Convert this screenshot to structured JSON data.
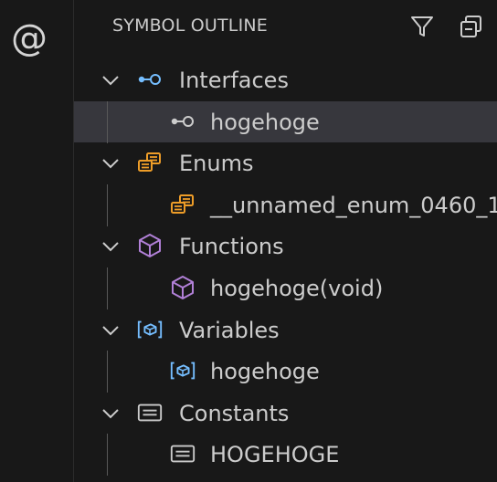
{
  "activity_bar": {
    "icon": "at-sign-icon",
    "glyph": "@"
  },
  "panel": {
    "title": "SYMBOL OUTLINE",
    "actions": [
      {
        "name": "filter-icon"
      },
      {
        "name": "collapse-all-icon"
      }
    ]
  },
  "tree": [
    {
      "label": "Interfaces",
      "icon": "interface-icon",
      "color": "#75beff",
      "expanded": true,
      "children": [
        {
          "label": "hogehoge",
          "icon": "interface-icon",
          "color": "#cccccc",
          "selected": true
        }
      ]
    },
    {
      "label": "Enums",
      "icon": "enum-icon",
      "color": "#ee9d28",
      "expanded": true,
      "children": [
        {
          "label": "__unnamed_enum_0460_1",
          "icon": "enum-icon",
          "color": "#ee9d28"
        }
      ]
    },
    {
      "label": "Functions",
      "icon": "function-cube-icon",
      "color": "#b180d7",
      "expanded": true,
      "children": [
        {
          "label": "hogehoge(void)",
          "icon": "function-cube-icon",
          "color": "#b180d7"
        }
      ]
    },
    {
      "label": "Variables",
      "icon": "variable-icon",
      "color": "#75beff",
      "expanded": true,
      "children": [
        {
          "label": "hogehoge",
          "icon": "variable-icon",
          "color": "#75beff"
        }
      ]
    },
    {
      "label": "Constants",
      "icon": "constant-icon",
      "color": "#cccccc",
      "expanded": true,
      "children": [
        {
          "label": "HOGEHOGE",
          "icon": "constant-icon",
          "color": "#cccccc"
        }
      ]
    }
  ]
}
